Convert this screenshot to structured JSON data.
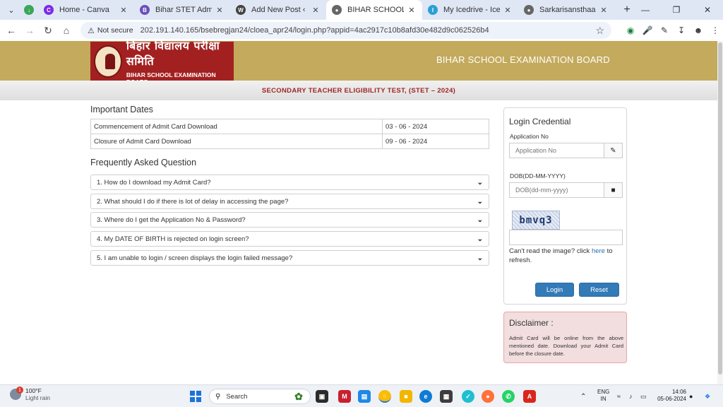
{
  "browser": {
    "tabs": [
      {
        "title": "Home - Canva",
        "icon": "canva-icon",
        "color": "#7d2ae8"
      },
      {
        "title": "Bihar STET Admit Card: Out",
        "icon": "site-icon",
        "color": "#6b4fbb"
      },
      {
        "title": "Add New Post ‹ Sarkarisansthaan",
        "icon": "wordpress-icon",
        "color": "#444444"
      },
      {
        "title": "BIHAR SCHOOL EXAMINATION",
        "icon": "globe-icon",
        "color": "#555555",
        "active": true
      },
      {
        "title": "My Icedrive - Icedrive",
        "icon": "icedrive-icon",
        "color": "#2a9fd6"
      },
      {
        "title": "Sarkarisansthaan - Latest",
        "icon": "globe-icon",
        "color": "#555555"
      }
    ],
    "new_tab_label": "+",
    "security_label": "Not secure",
    "url": "202.191.140.165/bsebregjan24/cloea_apr24/login.php?appid=4ac2917c10b8afd30e482d9c062526b4"
  },
  "header": {
    "logo_hindi": "बिहार विद्यालय परीक्षा समिति",
    "logo_english": "BIHAR SCHOOL EXAMINATION BOARD",
    "board_title": "BIHAR SCHOOL EXAMINATION BOARD",
    "subtitle": "SECONDARY TEACHER ELIGIBILITY TEST, (STET – 2024)"
  },
  "important_dates": {
    "title": "Important Dates",
    "rows": [
      {
        "label": "Commencement of Admit Card Download",
        "date": "03 - 06 - 2024"
      },
      {
        "label": "Closure of Admit Card Download",
        "date": "09 - 06 - 2024"
      }
    ]
  },
  "faq": {
    "title": "Frequently Asked Question",
    "items": [
      "1. How do I download my Admit Card?",
      "2. What should I do if there is lot of delay in accessing the page?",
      "3. Where do I get the Application No & Password?",
      "4. My DATE OF BIRTH is rejected on login screen?",
      "5. I am unable to login / screen displays the login failed message?"
    ]
  },
  "login": {
    "title": "Login Credential",
    "app_no_label": "Application No",
    "app_no_placeholder": "Application No",
    "dob_label": "DOB(DD-MM-YYYY)",
    "dob_placeholder": "DOB(dd-mm-yyyy)",
    "captcha_text": "bmvq3",
    "refresh_prefix": "Can't read the image? click ",
    "refresh_link": "here",
    "refresh_suffix": " to refresh.",
    "login_button": "Login",
    "reset_button": "Reset"
  },
  "disclaimer": {
    "title": "Disclaimer :",
    "text": "Admit Card will be online from the above mentioned date. Download your Admit Card before the closure date."
  },
  "taskbar": {
    "weather_temp": "100°F",
    "weather_desc": "Light rain",
    "weather_badge": "1",
    "search_label": "Search",
    "lang_line1": "ENG",
    "lang_line2": "IN",
    "time": "14:06",
    "date": "05-06-2024"
  }
}
